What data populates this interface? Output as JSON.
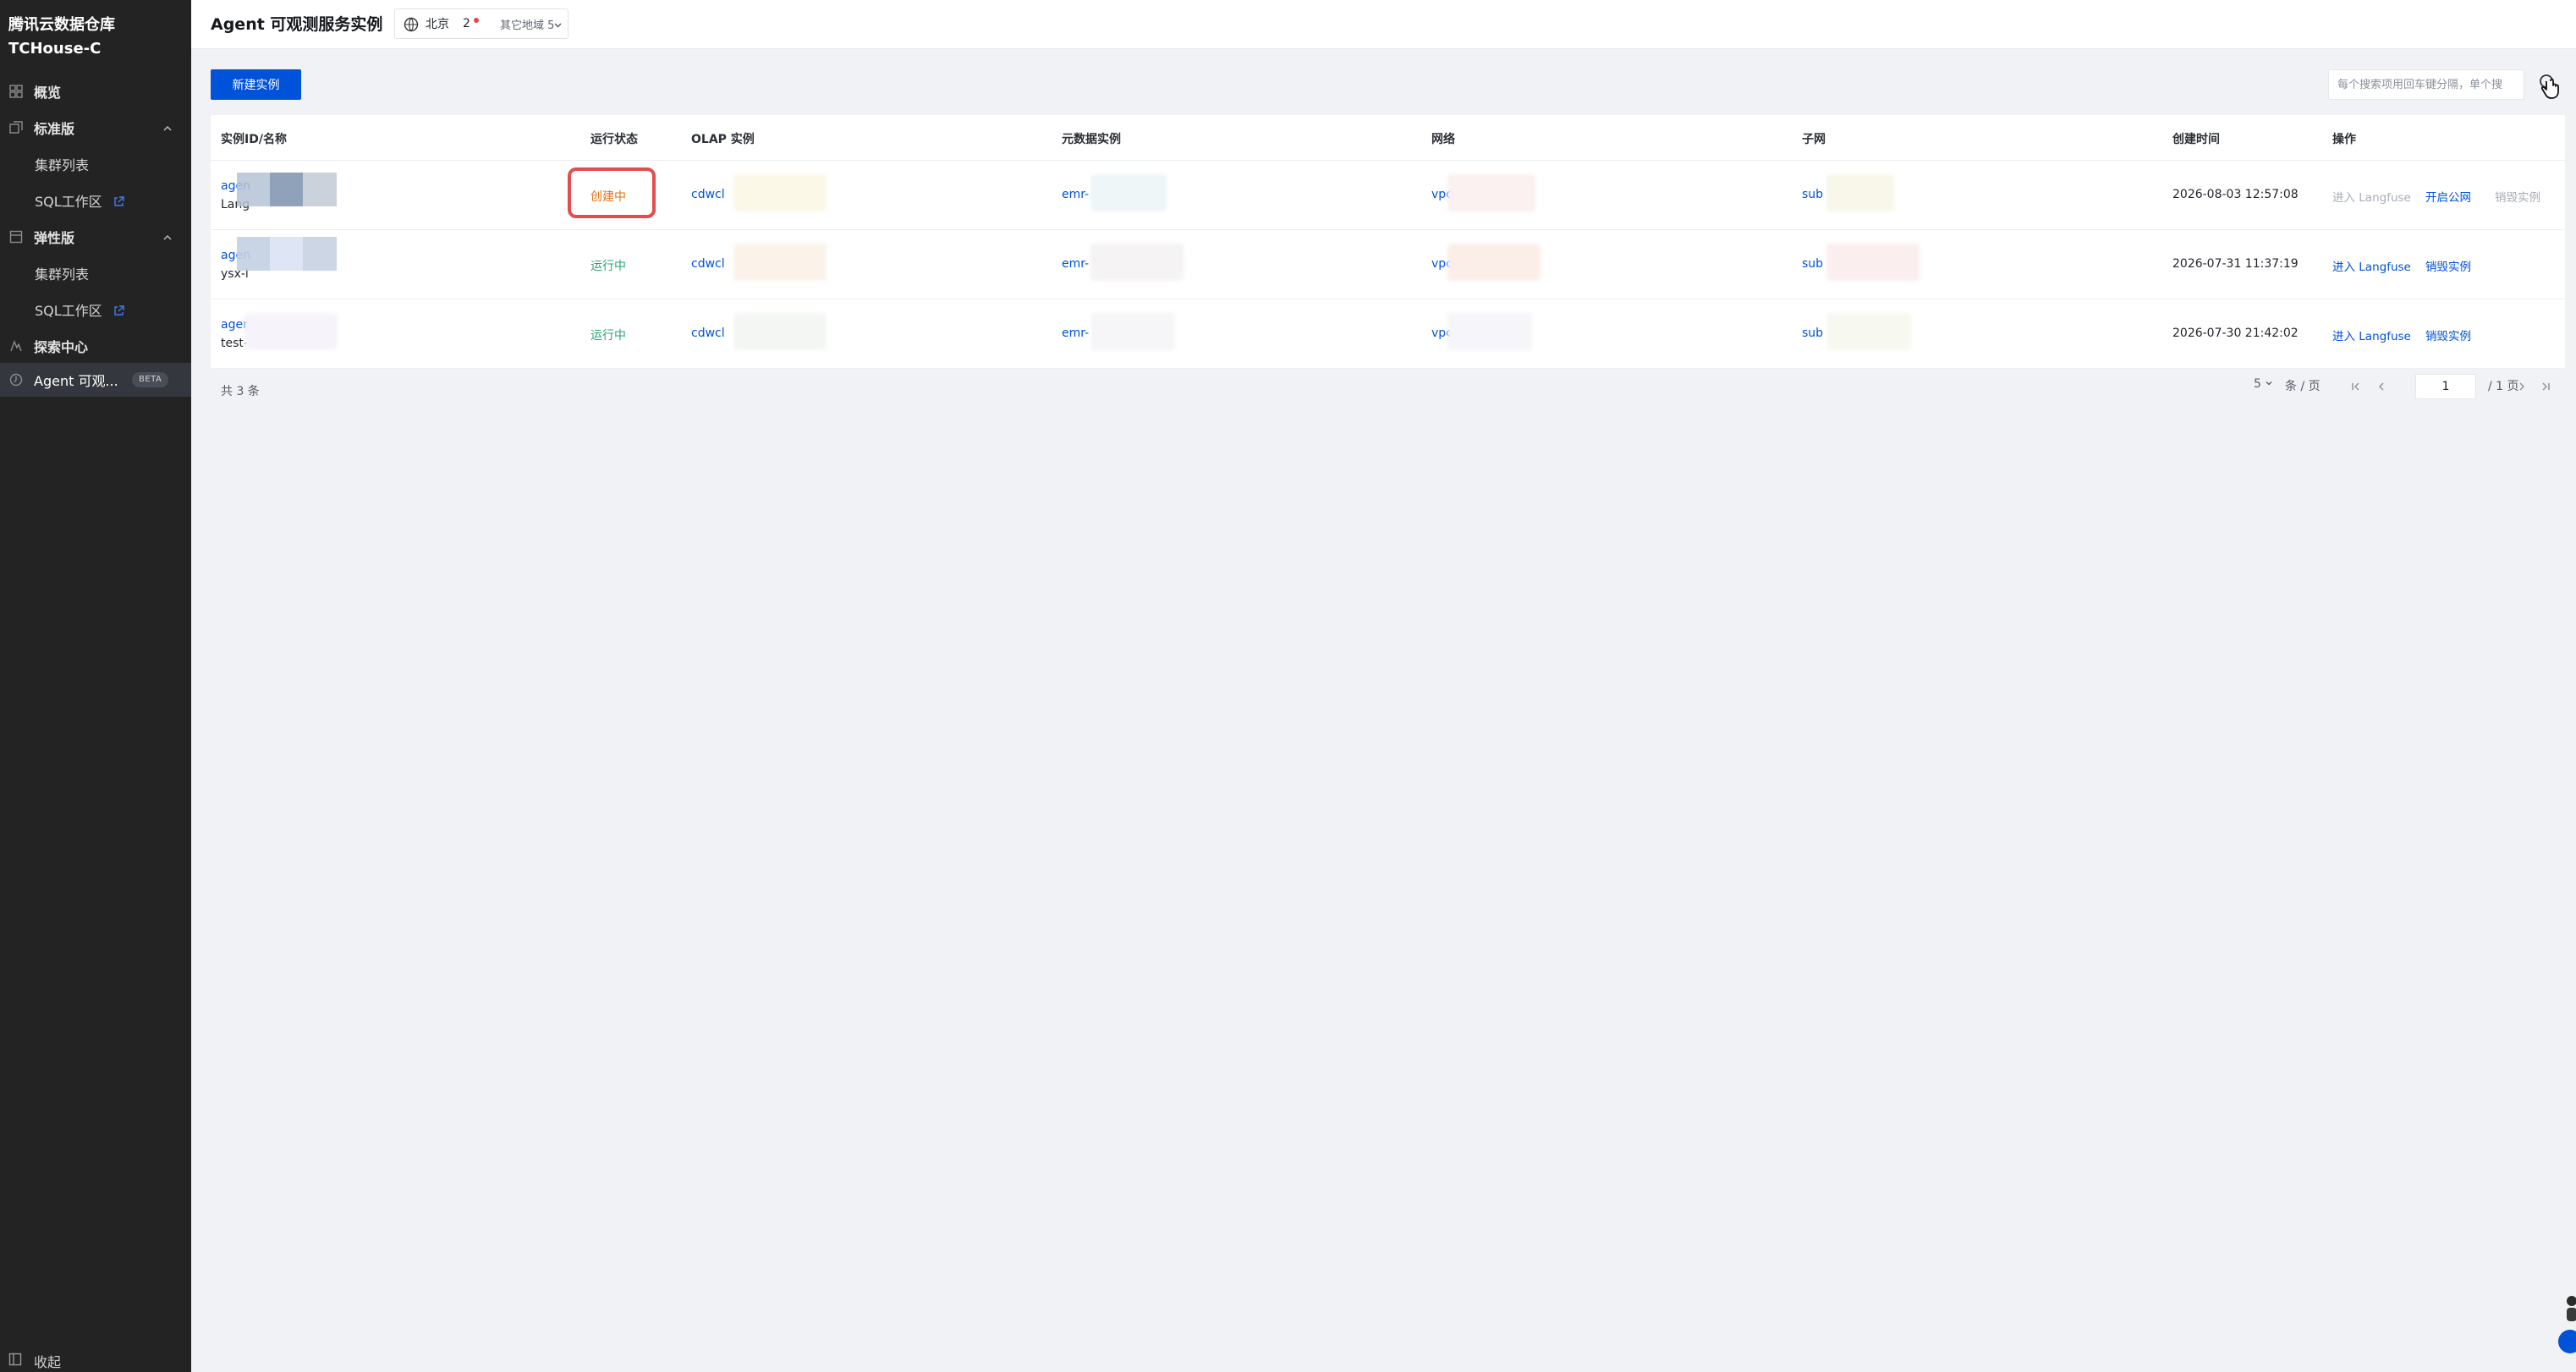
{
  "brand": {
    "line1": "腾讯云数据仓库",
    "line2": "TCHouse-C"
  },
  "sidebar": {
    "items": [
      {
        "label": "概览",
        "icon": "grid-icon"
      },
      {
        "label": "标准版",
        "icon": "layers-icon",
        "expanded": true
      },
      {
        "label": "集群列表",
        "sub": true
      },
      {
        "label": "SQL工作区",
        "sub": true,
        "external": true
      },
      {
        "label": "弹性版",
        "icon": "box-icon",
        "expanded": true
      },
      {
        "label": "集群列表",
        "sub": true
      },
      {
        "label": "SQL工作区",
        "sub": true,
        "external": true
      },
      {
        "label": "探索中心",
        "icon": "explore-icon"
      },
      {
        "label": "Agent 可观...",
        "icon": "agent-icon",
        "active": true,
        "badge": "BETA"
      }
    ],
    "collapse_label": "收起"
  },
  "header": {
    "title": "Agent 可观测服务实例",
    "region": "北京",
    "region_count": "2",
    "other_regions": "其它地域 5"
  },
  "toolbar": {
    "create_label": "新建实例",
    "search_placeholder": "每个搜索项用回车键分隔，单个搜"
  },
  "table": {
    "columns": [
      "实例ID/名称",
      "运行状态",
      "OLAP 实例",
      "元数据实例",
      "网络",
      "子网",
      "创建时间",
      "操作"
    ],
    "rows": [
      {
        "id": "agen",
        "name": "Lang",
        "status": "创建中",
        "olap": "cdwcl",
        "meta": "emr-",
        "vpc": "vpc",
        "subnet": "sub",
        "created": "2026-08-03 12:57:08",
        "ops": [
          "进入 Langfuse",
          "开启公网",
          "销毁实例"
        ]
      },
      {
        "id": "agen",
        "name": "ysx-l",
        "status": "运行中",
        "olap": "cdwcl",
        "meta": "emr-",
        "vpc": "vpc",
        "subnet": "sub",
        "created": "2026-07-31 11:37:19",
        "ops": [
          "进入 Langfuse",
          "销毁实例"
        ]
      },
      {
        "id": "agen",
        "name": "test-",
        "status": "运行中",
        "olap": "cdwcl",
        "meta": "emr-",
        "vpc": "vpc",
        "subnet": "sub",
        "created": "2026-07-30 21:42:02",
        "ops": [
          "进入 Langfuse",
          "销毁实例"
        ]
      }
    ]
  },
  "footer": {
    "total": "共 3 条",
    "page_size": "5",
    "per_page_unit": "条 / 页",
    "current_page": "1",
    "total_pages": "/ 1 页"
  },
  "colors": {
    "primary": "#0052d9",
    "creating": "#e37318",
    "running": "#2ba471",
    "highlight": "#e34d4d"
  }
}
